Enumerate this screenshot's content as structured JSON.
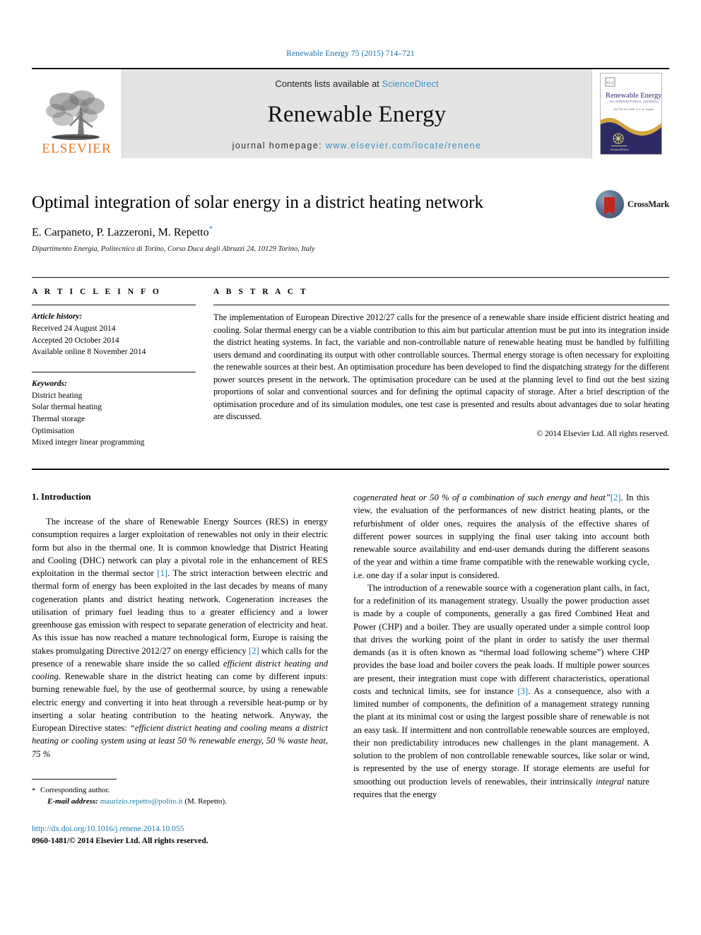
{
  "running_head": "Renewable Energy 75 (2015) 714–721",
  "masthead": {
    "publisher_name": "ELSEVIER",
    "contents_prefix": "Contents lists available at ",
    "contents_link": "ScienceDirect",
    "journal_name": "Renewable Energy",
    "homepage_prefix": "journal homepage: ",
    "homepage_url": "www.elsevier.com/locate/renene",
    "cover_title": "Renewable Energy",
    "cover_subtitle": "AN INTERNATIONAL JOURNAL",
    "cover_editors": "EDITOR-IN-CHIEF: A. A. M. Sayigh"
  },
  "article": {
    "title": "Optimal integration of solar energy in a district heating network",
    "authors": "E. Carpaneto, P. Lazzeroni, M. Repetto",
    "corresponding_marker": "*",
    "affiliation": "Dipartimento Energia, Politecnico di Torino, Corso Duca degli Abruzzi 24, 10129 Torino, Italy",
    "crossmark_label": "CrossMark"
  },
  "info": {
    "heading": "A R T I C L E   I N F O",
    "history_label": "Article history:",
    "history": [
      "Received 24 August 2014",
      "Accepted 20 October 2014",
      "Available online 8 November 2014"
    ],
    "keywords_label": "Keywords:",
    "keywords": [
      "District heating",
      "Solar thermal heating",
      "Thermal storage",
      "Optimisation",
      "Mixed integer linear programming"
    ]
  },
  "abstract": {
    "heading": "A B S T R A C T",
    "text": "The implementation of European Directive 2012/27 calls for the presence of a renewable share inside efficient district heating and cooling. Solar thermal energy can be a viable contribution to this aim but particular attention must be put into its integration inside the district heating systems. In fact, the variable and non-controllable nature of renewable heating must be handled by fulfilling users demand and coordinating its output with other controllable sources. Thermal energy storage is often necessary for exploiting the renewable sources at their best. An optimisation procedure has been developed to find the dispatching strategy for the different power sources present in the network. The optimisation procedure can be used at the planning level to find out the best sizing proportions of solar and conventional sources and for defining the optimal capacity of storage. After a brief description of the optimisation procedure and of its simulation modules, one test case is presented and results about advantages due to solar heating are discussed.",
    "copyright": "© 2014 Elsevier Ltd. All rights reserved."
  },
  "body": {
    "section_title": "1. Introduction",
    "left_p1_a": "The increase of the share of Renewable Energy Sources (RES) in energy consumption requires a larger exploitation of renewables not only in their electric form but also in the thermal one. It is common knowledge that District Heating and Cooling (DHC) network can play a pivotal role in the enhancement of RES exploitation in the thermal sector ",
    "ref1": "[1]",
    "left_p1_b": ". The strict interaction between electric and thermal form of energy has been exploited in the last decades by means of many cogeneration plants and district heating network. Cogeneration increases the utilisation of primary fuel leading thus to a greater efficiency and a lower greenhouse gas emission with respect to separate generation of electricity and heat. As this issue has now reached a mature technological form, Europe is raising the stakes promulgating Directive 2012/27 on energy efficiency ",
    "ref2": "[2]",
    "left_p1_c": " which calls for the presence of a renewable share inside the so called ",
    "left_p1_ital1": "efficient district heating and cooling",
    "left_p1_d": ". Renewable share in the district heating can come by different inputs: burning renewable fuel, by the use of geothermal source, by using a renewable electric energy and converting it into heat through a reversible heat-pump or by inserting a solar heating contribution to the heating network. Anyway, the European Directive states: ",
    "left_p1_ital2": "“efficient district heating and cooling means a district heating or cooling system using at least 50 % renewable energy, 50 % waste heat, 75 %",
    "right_p1_ital": "cogenerated heat or 50 % of a combination of such energy and heat”",
    "ref2b": "[2]",
    "right_p1_a": ". In this view, the evaluation of the performances of new district heating plants, or the refurbishment of older ones, requires the analysis of the effective shares of different power sources in supplying the final user taking into account both renewable source availability and end-user demands during the different seasons of the year and within a time frame compatible with the renewable working cycle, i.e. one day if a solar input is considered.",
    "right_p2_a": "The introduction of a renewable source with a cogeneration plant calls, in fact, for a redefinition of its management strategy. Usually the power production asset is made by a couple of components, generally a gas fired Combined Heat and Power (CHP) and a boiler. They are usually operated under a simple control loop that drives the working point of the plant in order to satisfy the user thermal demands (as it is often known as “thermal load following scheme”) where CHP provides the base load and boiler covers the peak loads. If multiple power sources are present, their integration must cope with different characteristics, operational costs and technical limits, see for instance ",
    "ref3": "[3]",
    "right_p2_b": ". As a consequence, also with a limited number of components, the definition of a management strategy running the plant at its minimal cost or using the largest possible share of renewable is not an easy task. If intermittent and non controllable renewable sources are employed, their non predictability introduces new challenges in the plant management. A solution to the problem of non controllable renewable sources, like solar or wind, is represented by the use of energy storage. If storage elements are useful for smoothing out production levels of renewables, their intrinsically ",
    "right_p2_ital": "integral",
    "right_p2_c": " nature requires that the energy"
  },
  "footnote": {
    "asterisk": "*",
    "corresponding": "Corresponding author.",
    "email_label": "E-mail address:",
    "email": "maurizio.repetto@polito.it",
    "email_suffix": "(M. Repetto)."
  },
  "footer": {
    "doi": "http://dx.doi.org/10.1016/j.renene.2014.10.055",
    "issn": "0960-1481/© 2014 Elsevier Ltd. All rights reserved."
  },
  "colors": {
    "link": "#1a7aa8",
    "elsevier_orange": "#E87722",
    "sciencedirect_blue": "#3a8fc4",
    "masthead_gray": "#e4e4e4",
    "crossmark_red": "#c0271d"
  }
}
